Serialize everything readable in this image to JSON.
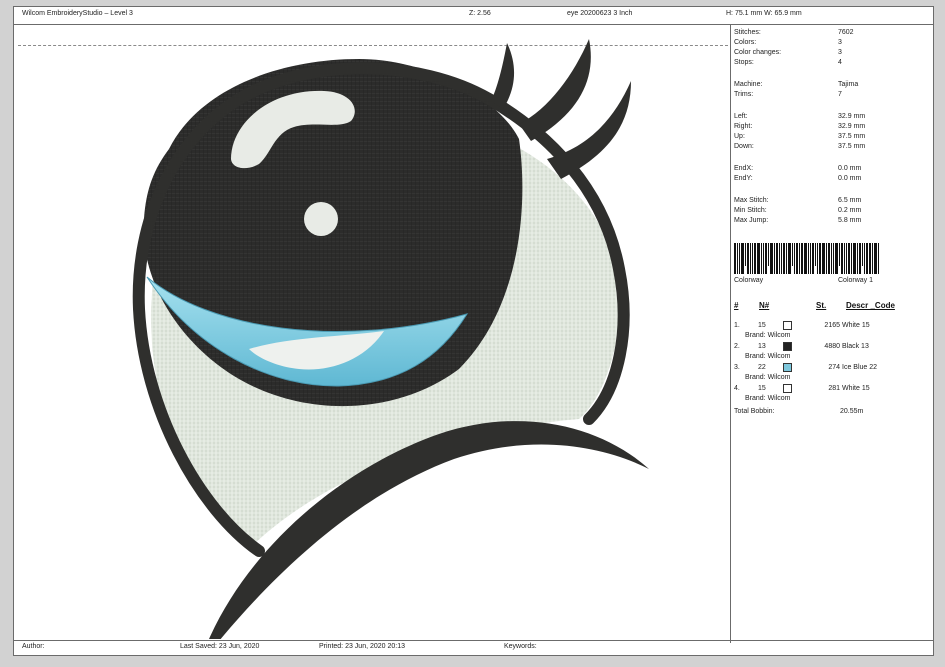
{
  "header": {
    "app_title": "Wilcom EmbroideryStudio – Level 3",
    "zoom": "Z: 2.56",
    "design_name": "eye 20200623 3 Inch",
    "dimensions": "H: 75.1 mm  W: 65.9 mm"
  },
  "stats": [
    {
      "label": "Stitches:",
      "value": "7602"
    },
    {
      "label": "Colors:",
      "value": "3"
    },
    {
      "label": "Color changes:",
      "value": "3"
    },
    {
      "label": "Stops:",
      "value": "4"
    },
    {
      "label": "Machine:",
      "value": "Tajima"
    },
    {
      "label": "Trims:",
      "value": "7"
    },
    {
      "label": "Left:",
      "value": "32.9 mm"
    },
    {
      "label": "Right:",
      "value": "32.9 mm"
    },
    {
      "label": "Up:",
      "value": "37.5 mm"
    },
    {
      "label": "Down:",
      "value": "37.5 mm"
    },
    {
      "label": "EndX:",
      "value": "0.0 mm"
    },
    {
      "label": "EndY:",
      "value": "0.0 mm"
    },
    {
      "label": "Max Stitch:",
      "value": "6.5 mm"
    },
    {
      "label": "Min Stitch:",
      "value": "0.2 mm"
    },
    {
      "label": "Max Jump:",
      "value": "5.8 mm"
    }
  ],
  "colorway": {
    "label": "Colorway",
    "value": "Colorway 1"
  },
  "table_headers": {
    "num": "#",
    "n": "N#",
    "st": "St.",
    "descr": "Descr _Code"
  },
  "threads": [
    {
      "idx": "1.",
      "n": "15",
      "swatch": "#ffffff",
      "stitches": "2165",
      "descr": "White 15",
      "brand": "Brand: Wilcom"
    },
    {
      "idx": "2.",
      "n": "13",
      "swatch": "#222222",
      "stitches": "4880",
      "descr": "Black 13",
      "brand": "Brand: Wilcom"
    },
    {
      "idx": "3.",
      "n": "22",
      "swatch": "#7ec8dd",
      "stitches": "274",
      "descr": "Ice Blue 22",
      "brand": "Brand: Wilcom"
    },
    {
      "idx": "4.",
      "n": "15",
      "swatch": "#ffffff",
      "stitches": "281",
      "descr": "White 15",
      "brand": "Brand: Wilcom"
    }
  ],
  "total_bobbin": {
    "label": "Total Bobbin:",
    "value": "20.55m"
  },
  "footer": {
    "author": "Author:",
    "last_saved": "Last Saved: 23 Jun, 2020",
    "printed": "Printed: 23 Jun, 2020 20:13",
    "keywords": "Keywords:"
  }
}
